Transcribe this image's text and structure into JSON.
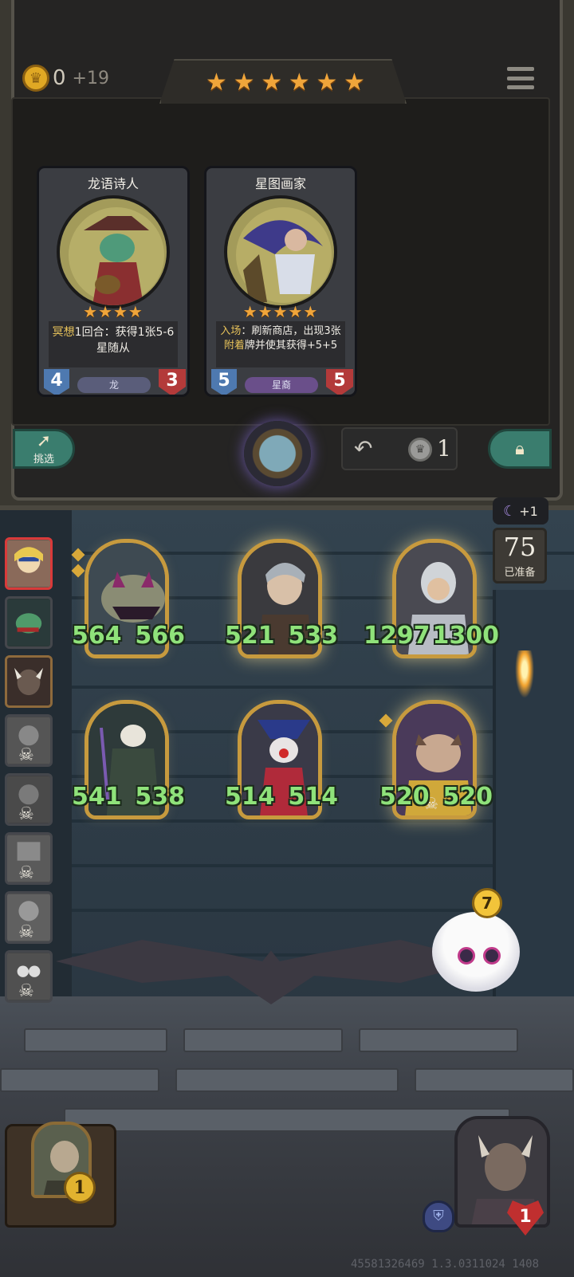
{
  "shop": {
    "gold": "0",
    "gold_income": "+19",
    "tier_stars": [
      "★",
      "★",
      "★",
      "★",
      "★",
      "★"
    ],
    "cards": [
      {
        "name": "龙语诗人",
        "stars": "★★★★",
        "text_prefix": "冥想",
        "text_rest": "1回合：获得1张5-6星随从",
        "tribe": "龙",
        "attack": "4",
        "health": "3"
      },
      {
        "name": "星图画家",
        "stars": "★★★★★",
        "text_prefix": "入场",
        "text_mid": "：刷新商店，出现3张",
        "text_hl": "附着",
        "text_rest": "牌并使其获得+5+5",
        "tribe": "星裔",
        "attack": "5",
        "health": "5"
      }
    ],
    "refresh_label": "挑选",
    "upgrade_cost": "1"
  },
  "turn": {
    "bonus": "+1",
    "ready_count": "75",
    "ready_label": "已准备"
  },
  "minions": [
    {
      "atk": "564",
      "hp": "566"
    },
    {
      "atk": "521",
      "hp": "533"
    },
    {
      "atk": "1297",
      "hp": "1300"
    },
    {
      "atk": "541",
      "hp": "538"
    },
    {
      "atk": "514",
      "hp": "514"
    },
    {
      "atk": "520",
      "hp": "520"
    }
  ],
  "player": {
    "tier": "1",
    "health": "1",
    "mascot_value": "7"
  },
  "watermark": "45581326469 1.3.0311024 1408"
}
